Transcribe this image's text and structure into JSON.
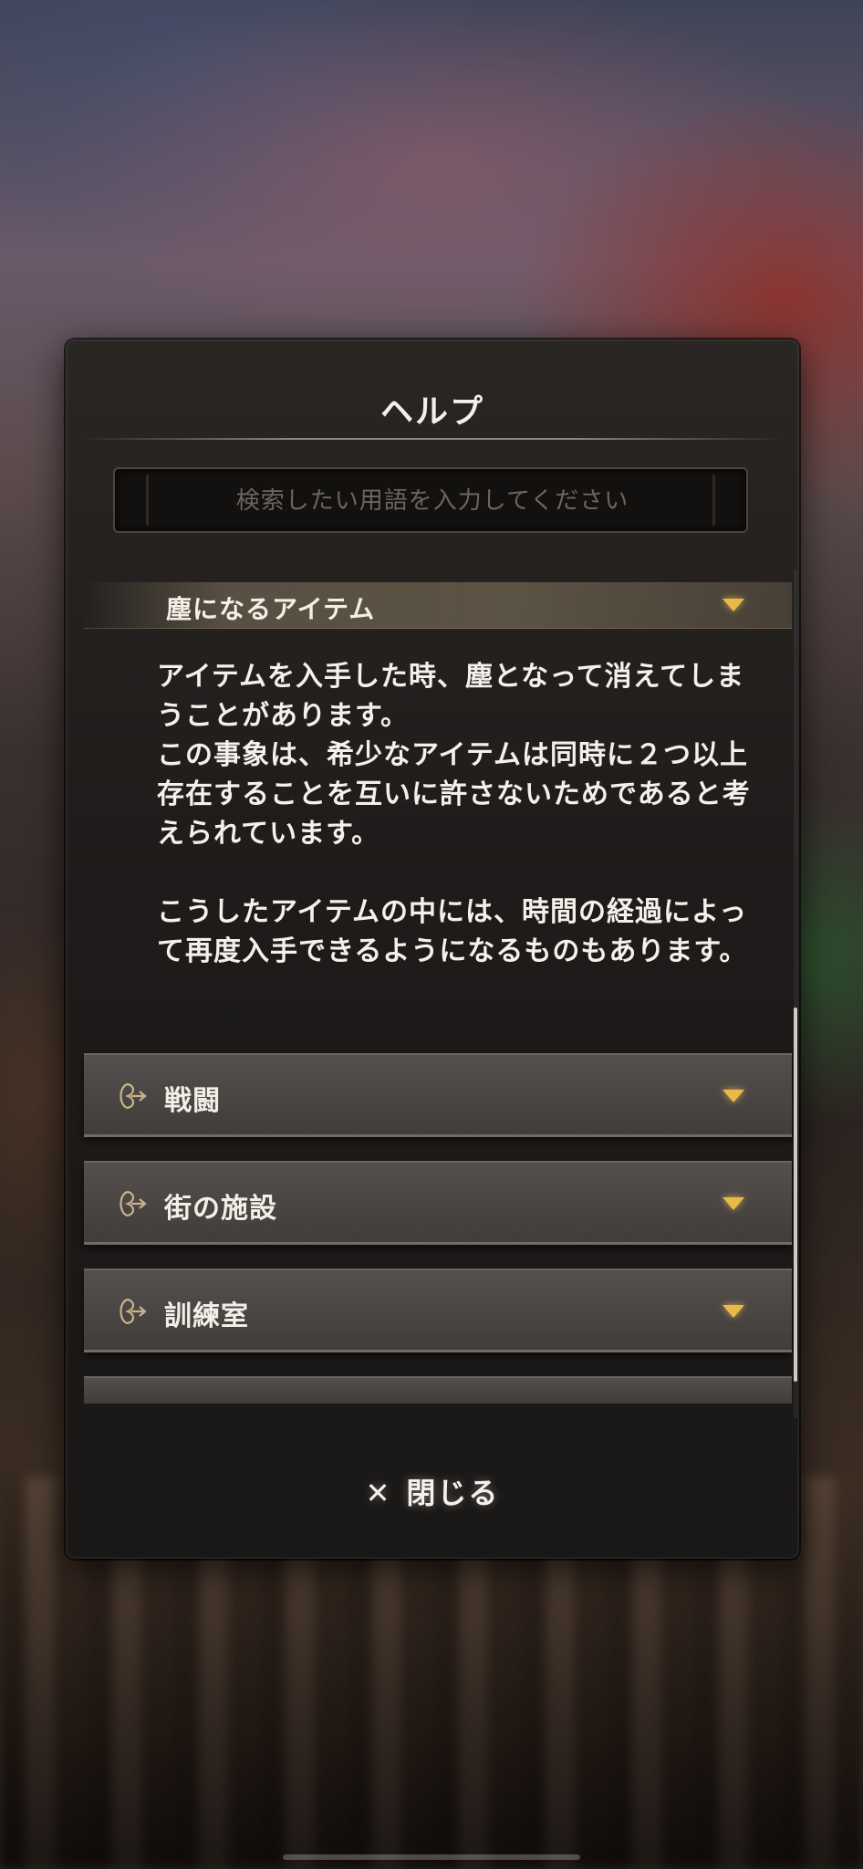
{
  "dialog": {
    "title": "ヘルプ",
    "search": {
      "value": "",
      "placeholder": "検索したい用語を入力してください"
    },
    "expanded_item": {
      "label": "塵になるアイテム",
      "icon": "chevron-down-icon",
      "body_paragraphs": [
        "アイテムを入手した時、塵となって消えてしまうことがあります。\nこの事象は、希少なアイテムは同時に２つ以上存在することを互いに許さないためであると考えられています。",
        "こうしたアイテムの中には、時間の経過によって再度入手できるようになるものもあります。"
      ]
    },
    "categories": [
      {
        "label": "戦闘",
        "icon": "ornate-arrow-icon"
      },
      {
        "label": "街の施設",
        "icon": "ornate-arrow-icon"
      },
      {
        "label": "訓練室",
        "icon": "ornate-arrow-icon"
      }
    ],
    "close_button": {
      "label": "閉じる",
      "icon": "close-x-icon"
    }
  },
  "colors": {
    "chevron": "#e9b94a",
    "text": "#f4f1ea",
    "panel": "#1e1b1a"
  }
}
